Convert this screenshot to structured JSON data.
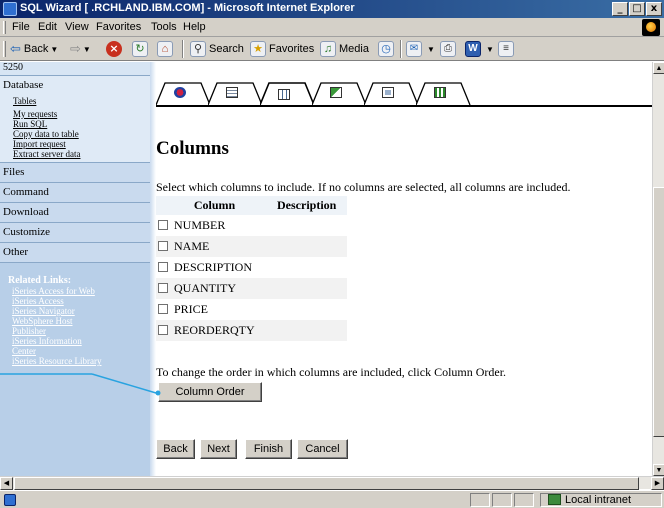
{
  "window": {
    "title": "SQL Wizard [          .RCHLAND.IBM.COM] - Microsoft Internet Explorer",
    "controls": [
      "_",
      "□",
      "x"
    ]
  },
  "menu": [
    "File",
    "Edit",
    "View",
    "Favorites",
    "Tools",
    "Help"
  ],
  "toolbar": {
    "back": "Back",
    "search": "Search",
    "favorites": "Favorites",
    "media": "Media"
  },
  "sidebar": {
    "top_label": "5250",
    "categories": [
      {
        "label": "Database",
        "links": [
          "Tables",
          "My requests",
          "Run SQL",
          "Copy data to table",
          "Import request",
          "Extract server data"
        ]
      },
      {
        "label": "Files"
      },
      {
        "label": "Command"
      },
      {
        "label": "Download"
      },
      {
        "label": "Customize"
      },
      {
        "label": "Other"
      }
    ],
    "related": {
      "heading": "Related Links:",
      "links": [
        "iSeries Access for Web",
        "iSeries Access",
        "iSeries Navigator",
        "WebSphere Host",
        "Publisher",
        "iSeries Information",
        "Center",
        "iSeries Resource Library"
      ]
    }
  },
  "tabs": [
    {
      "icon": "gem-icon",
      "active": false
    },
    {
      "icon": "table-icon",
      "active": false
    },
    {
      "icon": "columns-icon",
      "active": true
    },
    {
      "icon": "sort-icon",
      "active": false
    },
    {
      "icon": "screen-icon",
      "active": false
    },
    {
      "icon": "output-icon",
      "active": false
    }
  ],
  "main": {
    "title": "Columns",
    "instruction": "Select which columns to include. If no columns are selected, all columns are included.",
    "table": {
      "headers": [
        "Column",
        "Description"
      ],
      "rows": [
        {
          "column": "NUMBER",
          "description": "",
          "checked": false
        },
        {
          "column": "NAME",
          "description": "",
          "checked": false
        },
        {
          "column": "DESCRIPTION",
          "description": "",
          "checked": false
        },
        {
          "column": "QUANTITY",
          "description": "",
          "checked": false
        },
        {
          "column": "PRICE",
          "description": "",
          "checked": false
        },
        {
          "column": "REORDERQTY",
          "description": "",
          "checked": false
        }
      ]
    },
    "order_text": "To change the order in which columns are included, click Column Order.",
    "column_order_button": "Column Order",
    "nav_buttons": {
      "back": "Back",
      "next": "Next",
      "finish": "Finish",
      "cancel": "Cancel"
    }
  },
  "status": {
    "zone": "Local intranet"
  },
  "colors": {
    "titlebar": "#0a246a",
    "sidebar": "#b8cfe8",
    "callout_line": "#29a3e0"
  }
}
